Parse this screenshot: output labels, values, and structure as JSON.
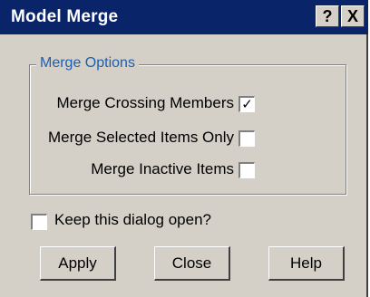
{
  "window": {
    "title": "Model Merge",
    "help_button": "?",
    "close_button": "X"
  },
  "group": {
    "label": "Merge Options",
    "options": [
      {
        "label": "Merge Crossing Members",
        "checked": true
      },
      {
        "label": "Merge Selected Items Only",
        "checked": false
      },
      {
        "label": "Merge Inactive Items",
        "checked": false
      }
    ]
  },
  "keep_open": {
    "label": "Keep this dialog open?",
    "checked": false
  },
  "buttons": {
    "apply": "Apply",
    "close": "Close",
    "help": "Help"
  },
  "check_mark": "✓",
  "colors": {
    "titlebar": "#0a246a",
    "face": "#d4d0c8",
    "group_label": "#1a5fb4"
  }
}
